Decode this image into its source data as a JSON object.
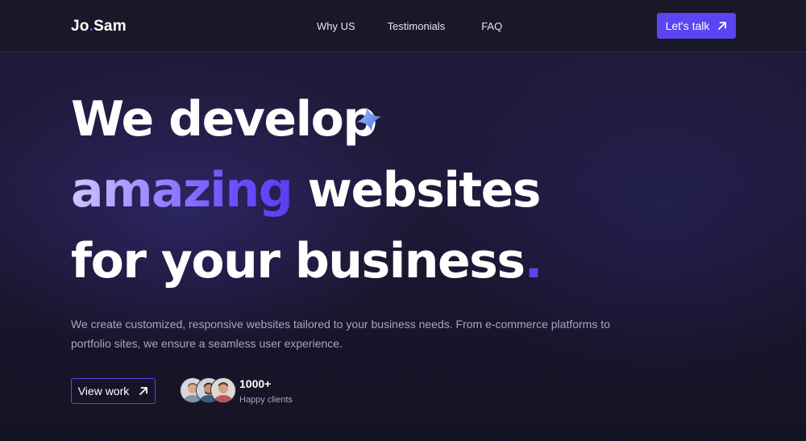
{
  "nav": {
    "logo_left": "Jo",
    "logo_dot": ".",
    "logo_right": "Sam",
    "links": [
      "Why US",
      "Testimonials",
      "FAQ"
    ],
    "cta_label": "Let's talk",
    "cta_icon": "arrow-up-right-icon"
  },
  "hero": {
    "line1": "We develop",
    "line2_highlight": "amazing",
    "line2_rest": " websites",
    "line3": "for your business",
    "line3_dot": ".",
    "sparkle_icon": "sparkle-icon",
    "description": "We create customized, responsive websites tailored to your business needs. From e-commerce platforms to portfolio sites, we ensure a seamless user experience.",
    "view_work_label": "View work",
    "view_work_icon": "arrow-up-right-icon",
    "clients_count": "1000+",
    "clients_label": "Happy clients"
  },
  "colors": {
    "accent": "#5b44f2",
    "background": "#1e1a3a",
    "nav_background": "#1a1828",
    "text": "#ffffff",
    "muted_text": "#a9a7bd"
  }
}
